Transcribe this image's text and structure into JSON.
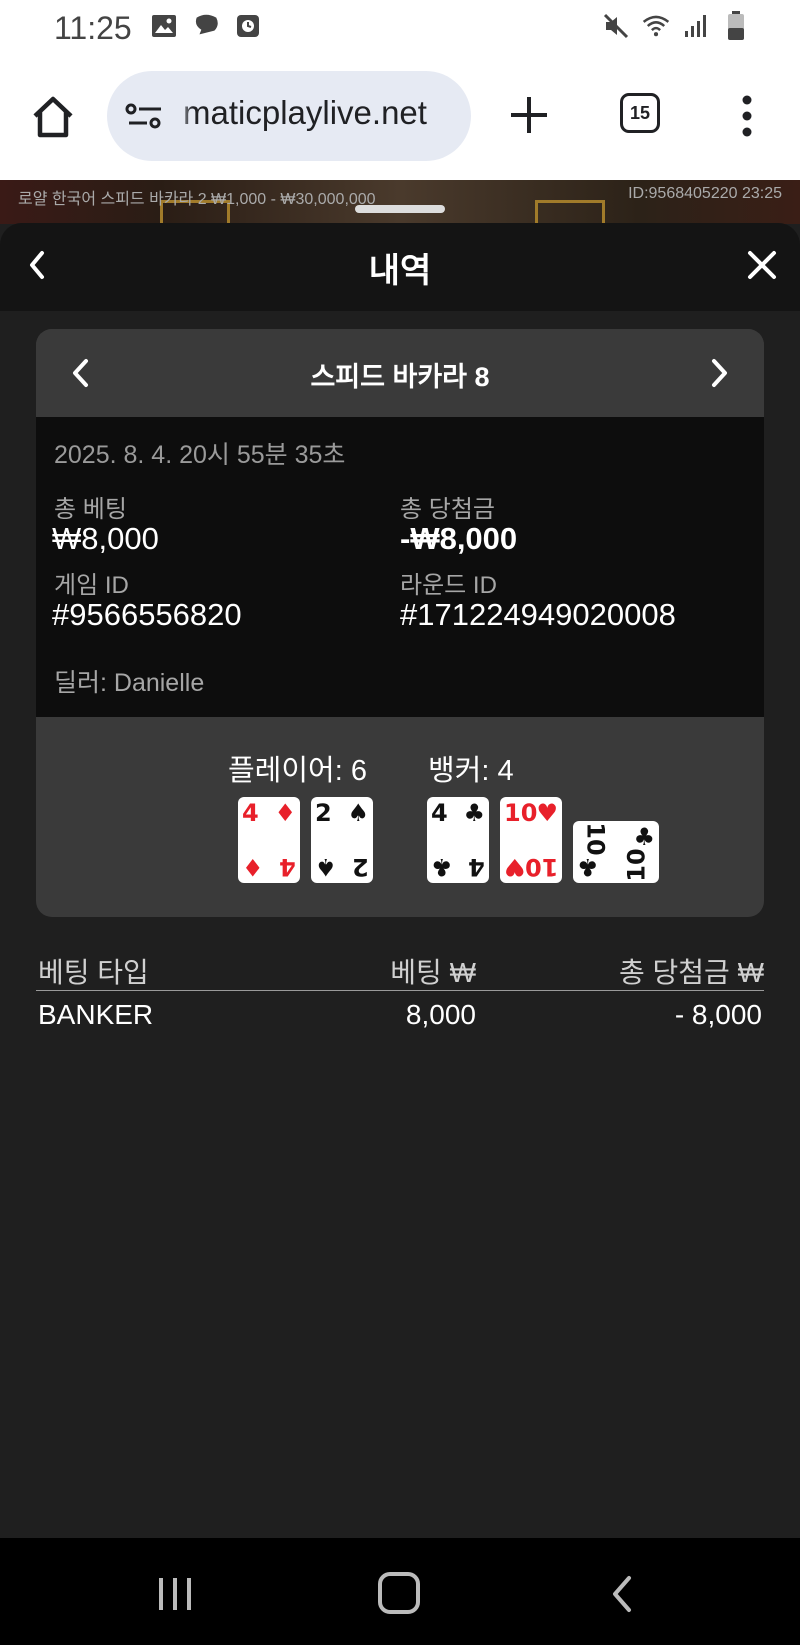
{
  "status_bar": {
    "time": "11:25",
    "left_icons": [
      "gallery-icon",
      "chat-bubble-icon",
      "clock-app-icon"
    ],
    "right_icons": [
      "mute-icon",
      "wifi-icon",
      "signal-icon",
      "battery-icon"
    ]
  },
  "browser": {
    "url": "maticplaylive.net",
    "tab_count": "15"
  },
  "game_strip": {
    "table_info": "로얄 한국어 스피드 바카라 2  ₩1,000 - ₩30,000,000",
    "session_info": "ID:9568405220  23:25"
  },
  "sheet": {
    "title": "내역"
  },
  "round": {
    "game_name": "스피드 바카라 8",
    "datetime": "2025. 8. 4. 20시 55분 35초",
    "total_bet_label": "총 베팅",
    "total_bet_value": "₩8,000",
    "total_win_label": "총 당첨금",
    "total_win_value": "-₩8,000",
    "game_id_label": "게임 ID",
    "game_id_value": "#9566556820",
    "round_id_label": "라운드 ID",
    "round_id_value": "#171224949020008",
    "dealer": "딜러: Danielle",
    "player_score": "플레이어: 6",
    "banker_score": "뱅커: 4",
    "player_cards": [
      {
        "rank": "4",
        "suit": "♦",
        "color": "#e8202a"
      },
      {
        "rank": "2",
        "suit": "♠",
        "color": "#111111"
      }
    ],
    "banker_cards": [
      {
        "rank": "4",
        "suit": "♣",
        "color": "#111111"
      },
      {
        "rank": "10",
        "suit": "♥",
        "color": "#e8202a"
      },
      {
        "rank": "10",
        "suit": "♣",
        "color": "#111111"
      }
    ]
  },
  "bets_table": {
    "headers": [
      "베팅 타입",
      "베팅 ₩",
      "총 당첨금 ₩"
    ],
    "rows": [
      {
        "type": "BANKER",
        "bet": "8,000",
        "win": "- 8,000"
      }
    ]
  }
}
